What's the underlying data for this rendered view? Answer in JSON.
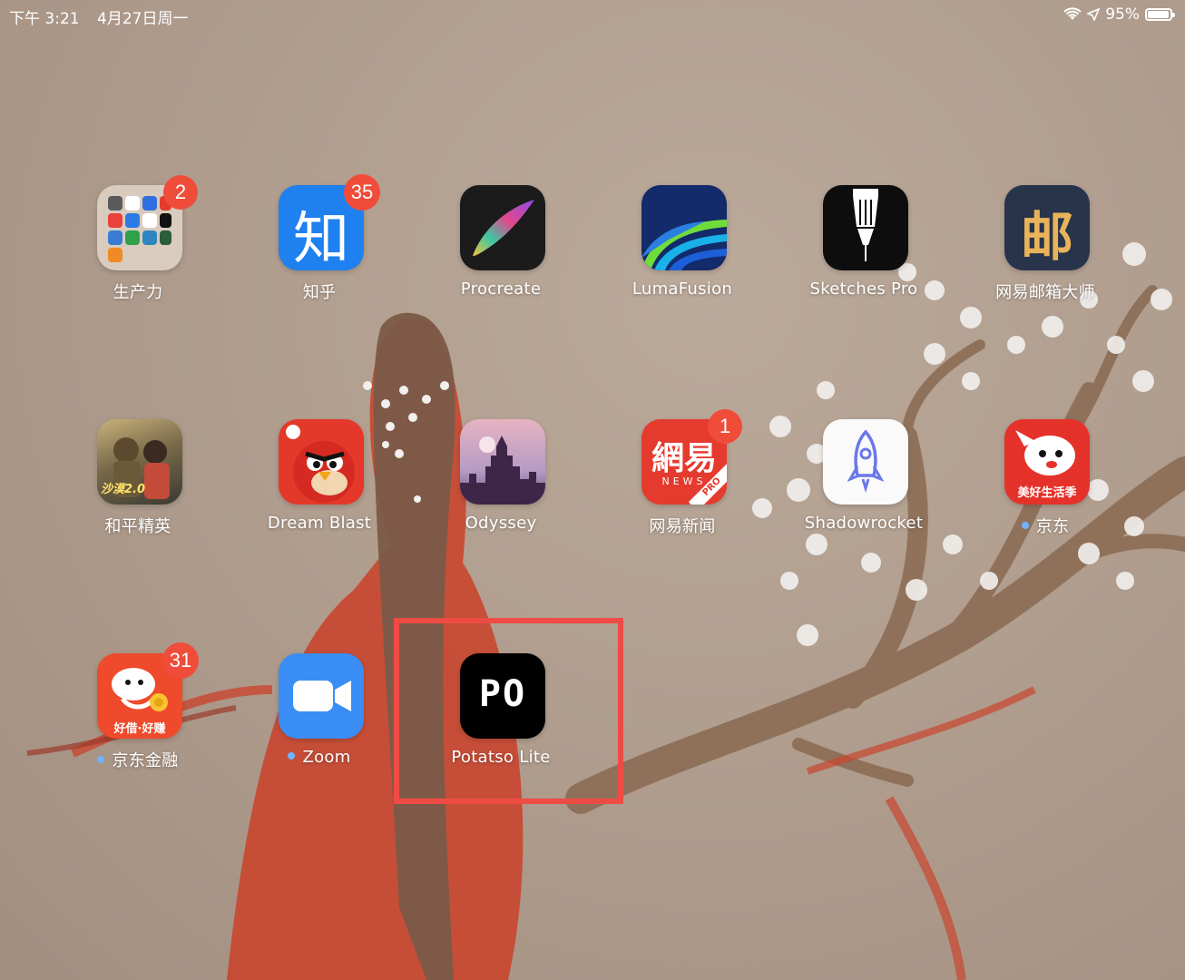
{
  "status_bar": {
    "time": "下午 3:21",
    "date": "4月27日周一",
    "battery_percent": "95%",
    "battery_level": 0.95,
    "icons": [
      "wifi-icon",
      "location-icon",
      "battery-icon"
    ]
  },
  "apps": [
    {
      "id": "productivity-folder",
      "label": "生产力",
      "badge": "2",
      "dot": false,
      "icon": "folder-icon"
    },
    {
      "id": "zhihu",
      "label": "知乎",
      "badge": "35",
      "dot": false,
      "icon": "zhihu-icon",
      "glyph": "知"
    },
    {
      "id": "procreate",
      "label": "Procreate",
      "badge": "",
      "dot": false,
      "icon": "procreate-icon"
    },
    {
      "id": "lumafusion",
      "label": "LumaFusion",
      "badge": "",
      "dot": false,
      "icon": "lumafusion-icon"
    },
    {
      "id": "sketches-pro",
      "label": "Sketches Pro",
      "badge": "",
      "dot": false,
      "icon": "pen-icon"
    },
    {
      "id": "netease-mail",
      "label": "网易邮箱大师",
      "badge": "",
      "dot": false,
      "icon": "mail-icon",
      "glyph": "邮"
    },
    {
      "id": "peace-elite",
      "label": "和平精英",
      "badge": "",
      "dot": false,
      "icon": "game-icon",
      "glyph": "沙漠2.0"
    },
    {
      "id": "dream-blast",
      "label": "Dream Blast",
      "badge": "",
      "dot": false,
      "icon": "angry-bird-icon"
    },
    {
      "id": "odyssey",
      "label": "Odyssey",
      "badge": "",
      "dot": false,
      "icon": "castle-icon"
    },
    {
      "id": "netease-news",
      "label": "网易新闻",
      "badge": "1",
      "dot": false,
      "icon": "news-icon",
      "glyph": "網易",
      "sub": "NEWS",
      "pro": "PRO"
    },
    {
      "id": "shadowrocket",
      "label": "Shadowrocket",
      "badge": "",
      "dot": false,
      "icon": "rocket-icon"
    },
    {
      "id": "jd",
      "label": "京东",
      "badge": "",
      "dot": true,
      "icon": "jd-dog-icon",
      "glyph": "美好生活季"
    },
    {
      "id": "jd-finance",
      "label": "京东金融",
      "badge": "31",
      "dot": true,
      "icon": "jd-finance-icon",
      "glyph": "好借·好赚"
    },
    {
      "id": "zoom",
      "label": "Zoom",
      "badge": "",
      "dot": true,
      "icon": "camera-icon"
    },
    {
      "id": "potatso-lite",
      "label": "Potatso Lite",
      "badge": "",
      "dot": false,
      "icon": "po-icon",
      "glyph": "PO"
    }
  ],
  "highlight": {
    "target": "potatso-lite",
    "color": "#ef4b45"
  }
}
